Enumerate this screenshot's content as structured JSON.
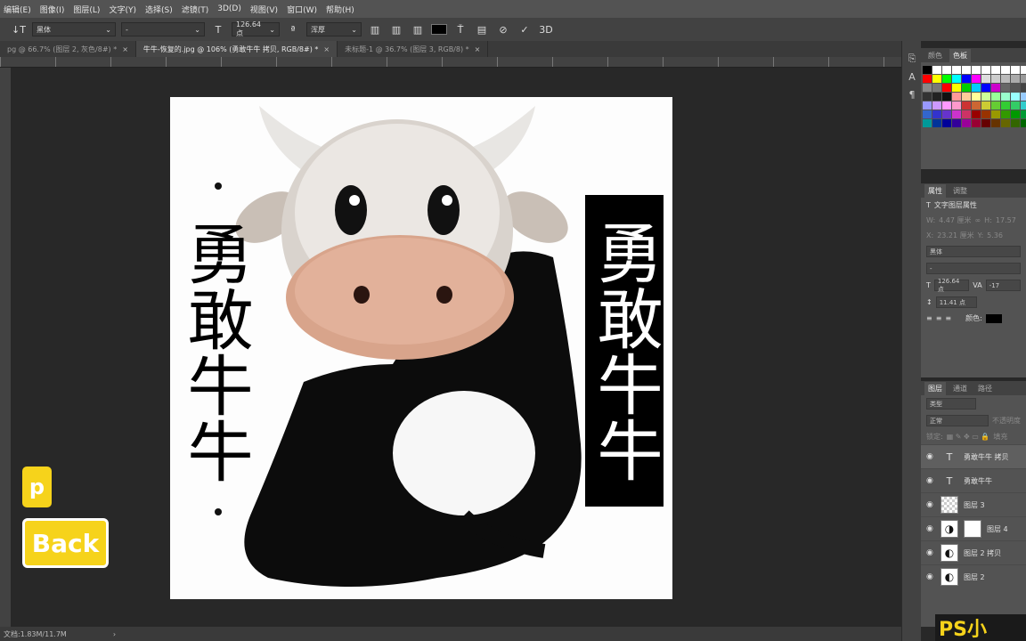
{
  "menu": [
    "编辑(E)",
    "图像(I)",
    "图层(L)",
    "文字(Y)",
    "选择(S)",
    "滤镜(T)",
    "3D(D)",
    "视图(V)",
    "窗口(W)",
    "帮助(H)"
  ],
  "options": {
    "font_family": "黑体",
    "font_style": "-",
    "font_size": "126.64 点",
    "antialias": "浑厚",
    "icon_labels": [
      "3D"
    ]
  },
  "tabs": [
    {
      "label": "pg @ 66.7% (图层 2, 灰色/8#) *"
    },
    {
      "label": "牛牛-恢复的.jpg @ 106% (勇敢牛牛 拷贝, RGB/8#) *"
    },
    {
      "label": "未标题-1 @ 36.7% (图层 3, RGB/8) *"
    }
  ],
  "canvas": {
    "left_text": "勇敢牛牛",
    "right_text": "勇敢牛牛"
  },
  "overlay": {
    "p_button": "p",
    "back_button": "Back"
  },
  "status": {
    "doc_size": "文档:1.83M/11.7M",
    "arrow": "›"
  },
  "panels": {
    "color_tabs": [
      "颜色",
      "色板"
    ],
    "props_tabs": [
      "属性",
      "调整"
    ],
    "text_layer_props": "文字图层属性",
    "w_label": "W:",
    "w_value": "4.47 厘米",
    "h_label": "H:",
    "h_value": "17.57",
    "x_label": "X:",
    "x_value": "23.21 厘米",
    "y_label": "Y:",
    "y_value": "5.36",
    "font": "黑体",
    "style": "-",
    "size": "126.64 点",
    "tracking": "-17",
    "leading": "11.41 点",
    "color_label": "颜色:",
    "layers_tabs": [
      "图层",
      "通道",
      "路径"
    ],
    "filter_placeholder": "类型",
    "blend_mode": "正常",
    "opacity_label": "不透明度",
    "lock_label": "锁定:",
    "fill_label": "填充"
  },
  "layers": [
    {
      "name": "勇敢牛牛 拷贝",
      "kind": "text",
      "selected": true
    },
    {
      "name": "勇敢牛牛",
      "kind": "text",
      "selected": false
    },
    {
      "name": "图层 3",
      "kind": "checker",
      "selected": false
    },
    {
      "name": "图层 4",
      "kind": "mask",
      "selected": false
    },
    {
      "name": "图层 2 拷贝",
      "kind": "image",
      "selected": false
    },
    {
      "name": "图层 2",
      "kind": "image",
      "selected": false
    }
  ],
  "brand_badge": "PS小",
  "colors": {
    "accent_yellow": "#f6d31b",
    "ui_dark": "#282828",
    "panel": "#535353"
  }
}
